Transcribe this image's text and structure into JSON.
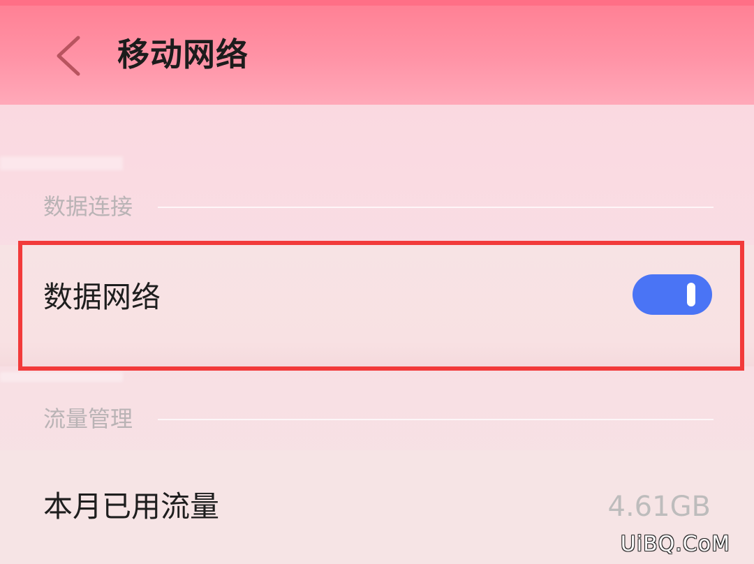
{
  "header": {
    "back_icon": "chevron-left-icon",
    "title": "移动网络"
  },
  "sections": {
    "data_connection": {
      "label": "数据连接",
      "data_network": {
        "label": "数据网络",
        "toggle_on": true,
        "toggle_color": "#4a74f5"
      }
    },
    "traffic_management": {
      "label": "流量管理",
      "monthly_usage": {
        "label": "本月已用流量",
        "value": "4.61GB"
      }
    }
  },
  "highlight_color": "#f23a3a",
  "watermark": "UiBQ.CoM"
}
